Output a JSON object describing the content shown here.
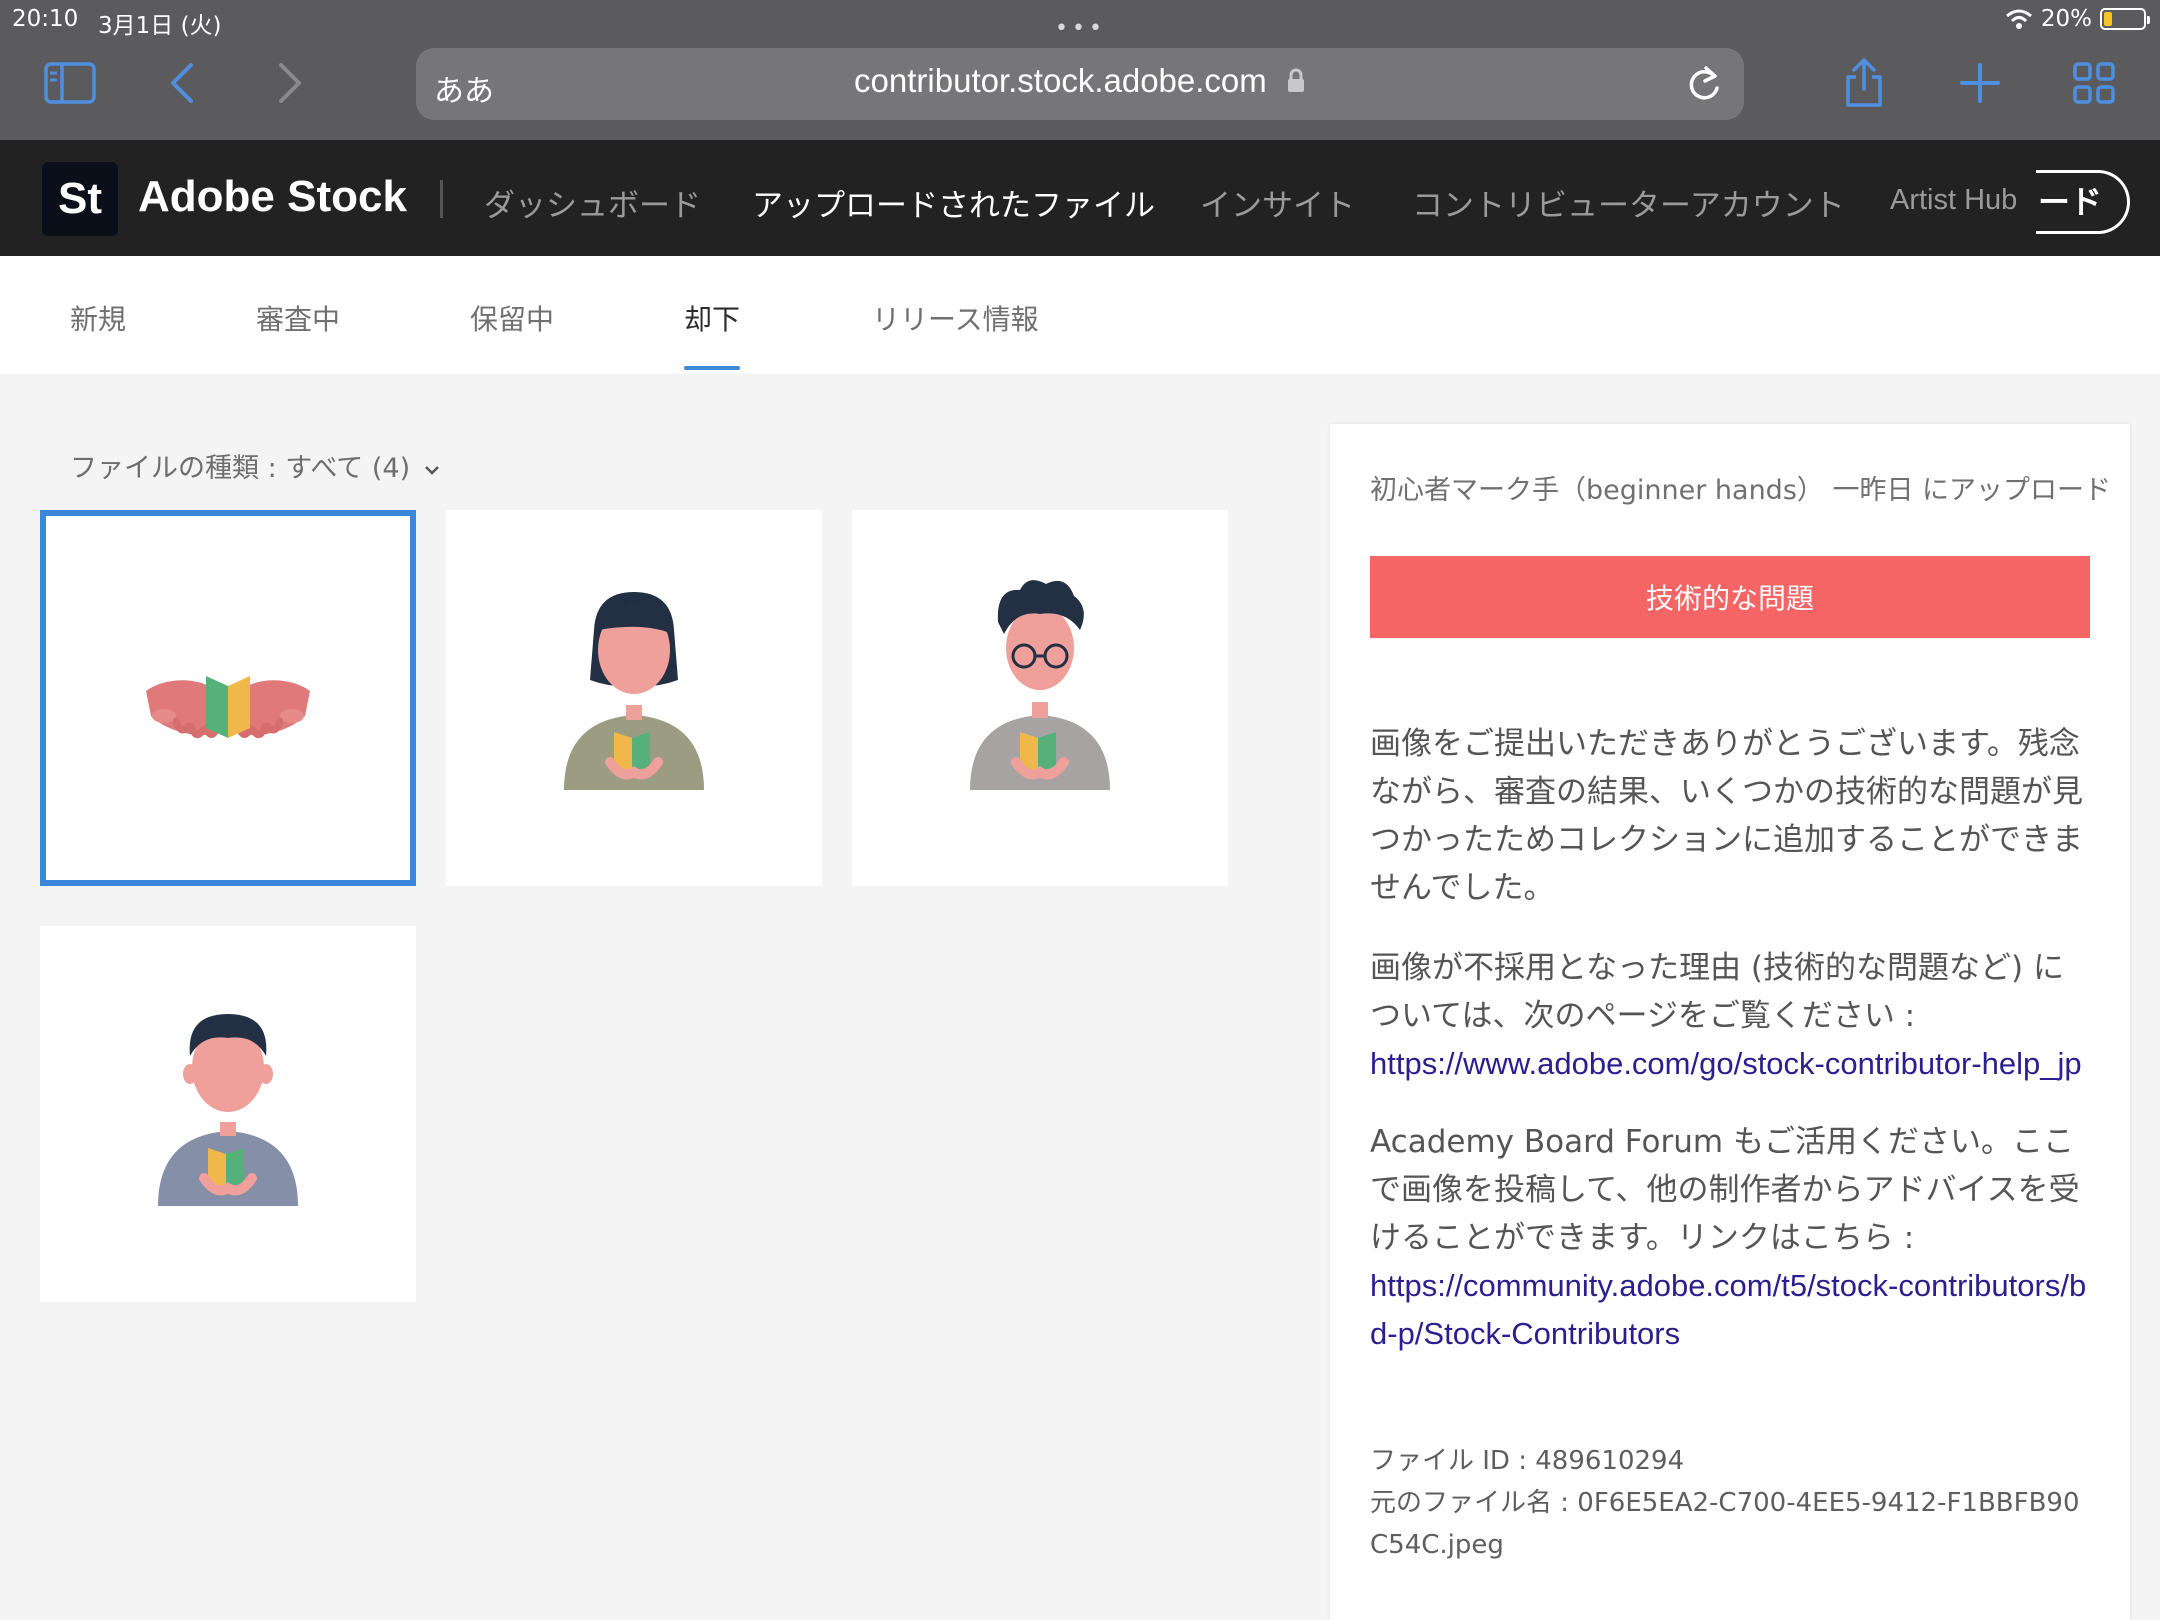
{
  "status_bar": {
    "time": "20:10",
    "date": "3月1日 (火)",
    "battery_pct": "20%",
    "battery_level": 0.2
  },
  "browser": {
    "text_size_label": "ああ",
    "url": "contributor.stock.adobe.com",
    "icons": [
      "sidebar-icon",
      "back-icon",
      "forward-icon",
      "lock-icon",
      "reload-icon",
      "share-icon",
      "new-tab-icon",
      "tabs-overview-icon"
    ]
  },
  "adobe_nav": {
    "logo_text": "St",
    "brand": "Adobe Stock",
    "links": {
      "dashboard": "ダッシュボード",
      "uploaded": "アップロードされたファイル",
      "insights": "インサイト",
      "account": "コントリビューターアカウント",
      "artist_hub": "Artist Hub"
    },
    "upload_button": "ード"
  },
  "subtabs": {
    "new": "新規",
    "in_review": "審査中",
    "pending": "保留中",
    "rejected": "却下",
    "releases": "リリース情報"
  },
  "filter_label": "ファイルの種類 : すべて (4)",
  "thumbnails": [
    {
      "name": "beginner-hands-thumbnail",
      "selected": true
    },
    {
      "name": "woman-with-mark-thumbnail",
      "selected": false
    },
    {
      "name": "man-with-glasses-thumbnail",
      "selected": false
    },
    {
      "name": "boy-with-mark-thumbnail",
      "selected": false
    }
  ],
  "detail": {
    "title": "初心者マーク手（beginner hands） 一昨日 にアップロード",
    "reason_badge": "技術的な問題",
    "para1": "画像をご提出いただきありがとうございます。残念ながら、審査の結果、いくつかの技術的な問題が見つかったためコレクションに追加することができませんでした。",
    "para2": "画像が不採用となった理由 (技術的な問題など) については、次のページをご覧ください :",
    "link1": "https://www.adobe.com/go/stock-contributor-help_jp",
    "para3": "Academy Board Forum もご活用ください。ここで画像を投稿して、他の制作者からアドバイスを受けることができます。リンクはこちら :",
    "link2": "https://community.adobe.com/t5/stock-contributors/bd-p/Stock-Contributors",
    "file_id": "ファイル ID : 489610294",
    "original_name": "元のファイル名 : 0F6E5EA2-C700-4EE5-9412-F1BBFB90C54C.jpeg"
  },
  "colors": {
    "selection_blue": "#3a86d8",
    "reject_red": "#f56565",
    "nav_dark": "#222222",
    "browser_blue": "#4f8fe0"
  }
}
